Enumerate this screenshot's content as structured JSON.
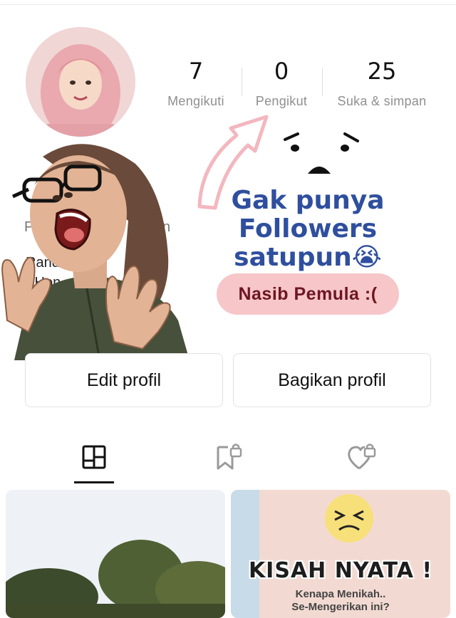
{
  "stats": [
    {
      "value": "7",
      "label": "Mengikuti"
    },
    {
      "value": "0",
      "label": "Pengikut"
    },
    {
      "value": "25",
      "label": "Suka & simpan"
    }
  ],
  "overlay": {
    "caption_line1": "Gak punya",
    "caption_line2": "Followers satupun😭",
    "badge": "Nasib Pemula :("
  },
  "bio_partial": {
    "p_fragment": "P",
    "n_fragment": "n",
    "rando_fragment": "Rando",
    "hon_fragment": "• Hon"
  },
  "buttons": {
    "edit": "Edit profil",
    "share": "Bagikan profil"
  },
  "tabs": [
    {
      "icon": "grid-icon",
      "active": true
    },
    {
      "icon": "bookmark-lock-icon",
      "active": false
    },
    {
      "icon": "heart-lock-icon",
      "active": false
    }
  ],
  "posts": [
    {
      "title": "",
      "subtitle": ""
    },
    {
      "title": "KISAH NYATA !",
      "subtitle_line1": "Kenapa Menikah..",
      "subtitle_line2": "Se-Mengerikan ini?"
    }
  ],
  "colors": {
    "caption": "#2f4f9e",
    "badge_bg": "#f7c6c8",
    "badge_text": "#6d1622"
  }
}
